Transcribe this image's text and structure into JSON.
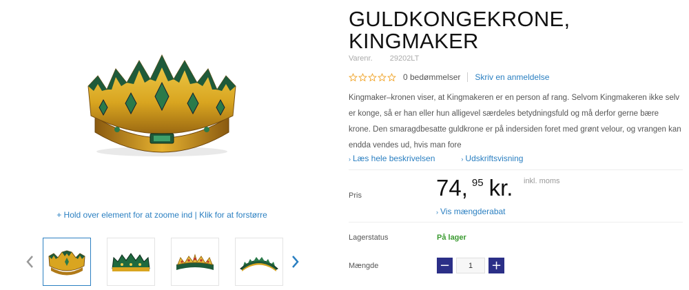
{
  "product": {
    "title": "GULDKONGEKRONE, KINGMAKER",
    "sku_label": "Varenr.",
    "sku_value": "29202LT",
    "rating": {
      "stars": 0,
      "max": 5,
      "count_label": "0 bedømmelser",
      "review_link": "Skriv en anmeldelse"
    },
    "description": "Kingmaker–kronen viser, at Kingmakeren er en person af rang. Selvom Kingmakeren ikke selv er konge, så er han eller hun alligevel særdeles betydningsfuld og må derfor gerne bære krone. Den smaragdbesatte guldkrone er på indersiden foret med grønt velour, og vrangen kan endda vendes ud, hvis man fore",
    "links": {
      "read_more": "Læs hele beskrivelsen",
      "print_view": "Udskriftsvisning"
    }
  },
  "gallery": {
    "zoom_hint": "+ Hold over element for at zoome ind | Klik for at forstørre",
    "thumbnails": [
      "crown-gold-front",
      "crown-green-flat",
      "crown-gold-flat",
      "crown-green-arc"
    ],
    "active_index": 0
  },
  "price": {
    "label": "Pris",
    "main": "74,",
    "decimals": "95",
    "currency": "kr.",
    "tax_note": "inkl. moms",
    "quantity_discount_link": "Vis mængderabat"
  },
  "stock": {
    "label": "Lagerstatus",
    "value": "På lager"
  },
  "quantity": {
    "label": "Mængde",
    "value": "1",
    "minus": "−",
    "plus": "+"
  },
  "colors": {
    "accent": "#2a7fc1",
    "qty_button": "#2b2f87",
    "in_stock": "#3a9a30",
    "crown_gold": "#d9a520",
    "crown_green": "#1f5a3a"
  }
}
